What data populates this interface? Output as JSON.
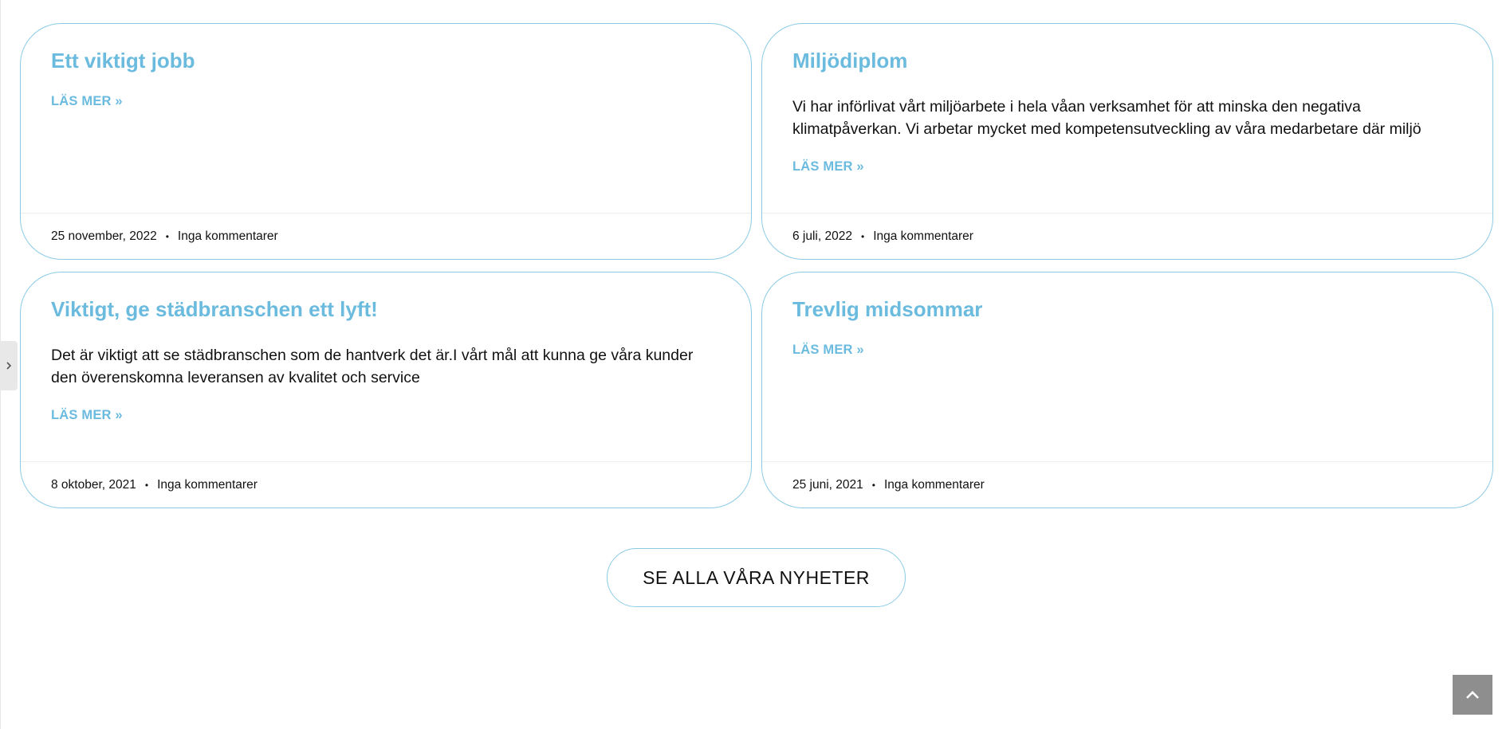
{
  "posts": [
    {
      "title": "Ett viktigt jobb",
      "excerpt": "",
      "read_more": "LÄS MER »",
      "date": "25 november, 2022",
      "separator": "•",
      "comments": "Inga kommentarer"
    },
    {
      "title": "Miljödiplom",
      "excerpt": "Vi har införlivat vårt miljöarbete i hela våan verksamhet för att minska den negativa klimatpåverkan. Vi arbetar mycket med kompetensutveckling av våra medarbetare där miljö",
      "read_more": "LÄS MER »",
      "date": "6 juli, 2022",
      "separator": "•",
      "comments": "Inga kommentarer"
    },
    {
      "title": "Viktigt, ge städbranschen ett lyft!",
      "excerpt": "Det är viktigt att se städbranschen som de hantverk det är.I vårt mål att kunna ge våra kunder den överenskomna leveransen av kvalitet och service",
      "read_more": "LÄS MER »",
      "date": "8 oktober, 2021",
      "separator": "•",
      "comments": "Inga kommentarer"
    },
    {
      "title": "Trevlig midsommar",
      "excerpt": "",
      "read_more": "LÄS MER »",
      "date": "25 juni, 2021",
      "separator": "•",
      "comments": "Inga kommentarer"
    }
  ],
  "all_news_button": "SE ALLA VÅRA NYHETER",
  "icons": {
    "side_tab": "chevron-right-icon",
    "scroll_top": "chevron-up-icon"
  },
  "colors": {
    "accent": "#6bbbdf",
    "card_border": "#8ccbe6",
    "scroll_top_bg": "#8e8e8e"
  }
}
